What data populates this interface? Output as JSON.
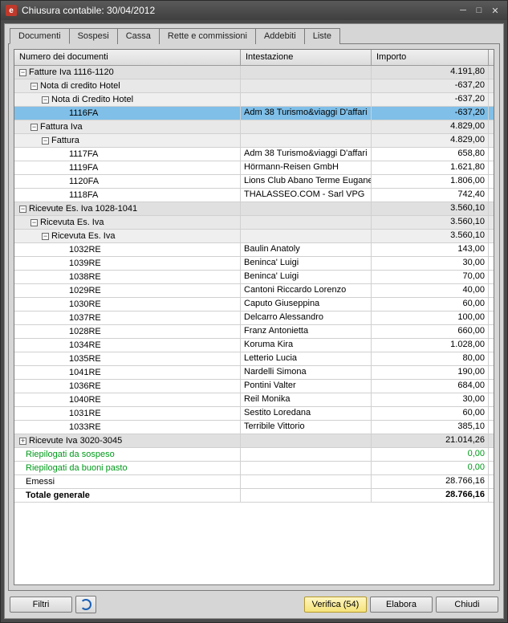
{
  "window": {
    "title": "Chiusura contabile: 30/04/2012",
    "app_glyph": "e"
  },
  "tabs": [
    {
      "label": "Documenti",
      "active": true
    },
    {
      "label": "Sospesi",
      "active": false
    },
    {
      "label": "Cassa",
      "active": false
    },
    {
      "label": "Rette e commissioni",
      "active": false
    },
    {
      "label": "Addebiti",
      "active": false
    },
    {
      "label": "Liste",
      "active": false
    }
  ],
  "columns": {
    "doc": "Numero dei documenti",
    "int": "Intestazione",
    "imp": "Importo"
  },
  "rows": [
    {
      "level": 0,
      "type": "group1",
      "toggle": "-",
      "doc": "Fatture Iva 1116-1120",
      "int": "",
      "imp": "4.191,80"
    },
    {
      "level": 1,
      "type": "group2",
      "toggle": "-",
      "doc": "Nota di credito Hotel",
      "int": "",
      "imp": "-637,20"
    },
    {
      "level": 2,
      "type": "group3",
      "toggle": "-",
      "doc": "Nota di Credito Hotel",
      "int": "",
      "imp": "-637,20"
    },
    {
      "level": 3,
      "type": "leaf selected",
      "doc": "1116FA",
      "int": "Adm 38 Turismo&viaggi D'affari",
      "imp": "-637,20"
    },
    {
      "level": 1,
      "type": "group2",
      "toggle": "-",
      "doc": "Fattura Iva",
      "int": "",
      "imp": "4.829,00"
    },
    {
      "level": 2,
      "type": "group3",
      "toggle": "-",
      "doc": "Fattura",
      "int": "",
      "imp": "4.829,00"
    },
    {
      "level": 3,
      "type": "leaf",
      "doc": "1117FA",
      "int": "Adm 38 Turismo&viaggi D'affari",
      "imp": "658,80"
    },
    {
      "level": 3,
      "type": "leaf",
      "doc": "1119FA",
      "int": "Hörmann-Reisen GmbH",
      "imp": "1.621,80"
    },
    {
      "level": 3,
      "type": "leaf",
      "doc": "1120FA",
      "int": "Lions Club Abano Terme Euganee",
      "imp": "1.806,00"
    },
    {
      "level": 3,
      "type": "leaf",
      "doc": "1118FA",
      "int": "THALASSEO.COM - Sarl VPG",
      "imp": "742,40"
    },
    {
      "level": 0,
      "type": "group1",
      "toggle": "-",
      "doc": "Ricevute Es. Iva 1028-1041",
      "int": "",
      "imp": "3.560,10"
    },
    {
      "level": 1,
      "type": "group2",
      "toggle": "-",
      "doc": "Ricevuta Es. Iva",
      "int": "",
      "imp": "3.560,10"
    },
    {
      "level": 2,
      "type": "group3",
      "toggle": "-",
      "doc": "Ricevuta Es. Iva",
      "int": "",
      "imp": "3.560,10"
    },
    {
      "level": 3,
      "type": "leaf",
      "doc": "1032RE",
      "int": "Baulin Anatoly",
      "imp": "143,00"
    },
    {
      "level": 3,
      "type": "leaf",
      "doc": "1039RE",
      "int": "Beninca' Luigi",
      "imp": "30,00"
    },
    {
      "level": 3,
      "type": "leaf",
      "doc": "1038RE",
      "int": "Beninca' Luigi",
      "imp": "70,00"
    },
    {
      "level": 3,
      "type": "leaf",
      "doc": "1029RE",
      "int": "Cantoni Riccardo Lorenzo",
      "imp": "40,00"
    },
    {
      "level": 3,
      "type": "leaf",
      "doc": "1030RE",
      "int": "Caputo Giuseppina",
      "imp": "60,00"
    },
    {
      "level": 3,
      "type": "leaf",
      "doc": "1037RE",
      "int": "Delcarro Alessandro",
      "imp": "100,00"
    },
    {
      "level": 3,
      "type": "leaf",
      "doc": "1028RE",
      "int": "Franz Antonietta",
      "imp": "660,00"
    },
    {
      "level": 3,
      "type": "leaf",
      "doc": "1034RE",
      "int": "Koruma Kira",
      "imp": "1.028,00"
    },
    {
      "level": 3,
      "type": "leaf",
      "doc": "1035RE",
      "int": "Letterio Lucia",
      "imp": "80,00"
    },
    {
      "level": 3,
      "type": "leaf",
      "doc": "1041RE",
      "int": "Nardelli Simona",
      "imp": "190,00"
    },
    {
      "level": 3,
      "type": "leaf",
      "doc": "1036RE",
      "int": "Pontini Valter",
      "imp": "684,00"
    },
    {
      "level": 3,
      "type": "leaf",
      "doc": "1040RE",
      "int": "Reil Monika",
      "imp": "30,00"
    },
    {
      "level": 3,
      "type": "leaf",
      "doc": "1031RE",
      "int": "Sestito Loredana",
      "imp": "60,00"
    },
    {
      "level": 3,
      "type": "leaf",
      "doc": "1033RE",
      "int": "Terribile Vittorio",
      "imp": "385,10"
    },
    {
      "level": 0,
      "type": "group1",
      "toggle": "+",
      "doc": "Ricevute Iva 3020-3045",
      "int": "",
      "imp": "21.014,26"
    },
    {
      "level": 0,
      "type": "leaf green",
      "doc": "Riepilogati da sospeso",
      "int": "",
      "imp": "0,00",
      "noind": true
    },
    {
      "level": 0,
      "type": "leaf green",
      "doc": "Riepilogati da buoni pasto",
      "int": "",
      "imp": "0,00",
      "noind": true
    },
    {
      "level": 0,
      "type": "leaf",
      "doc": "Emessi",
      "int": "",
      "imp": "28.766,16",
      "noind": true
    },
    {
      "level": 0,
      "type": "leaf bold",
      "doc": "Totale generale",
      "int": "",
      "imp": "28.766,16",
      "noind": true
    }
  ],
  "buttons": {
    "filtri": "Filtri",
    "verifica": "Verifica (54)",
    "elabora": "Elabora",
    "chiudi": "Chiudi"
  }
}
